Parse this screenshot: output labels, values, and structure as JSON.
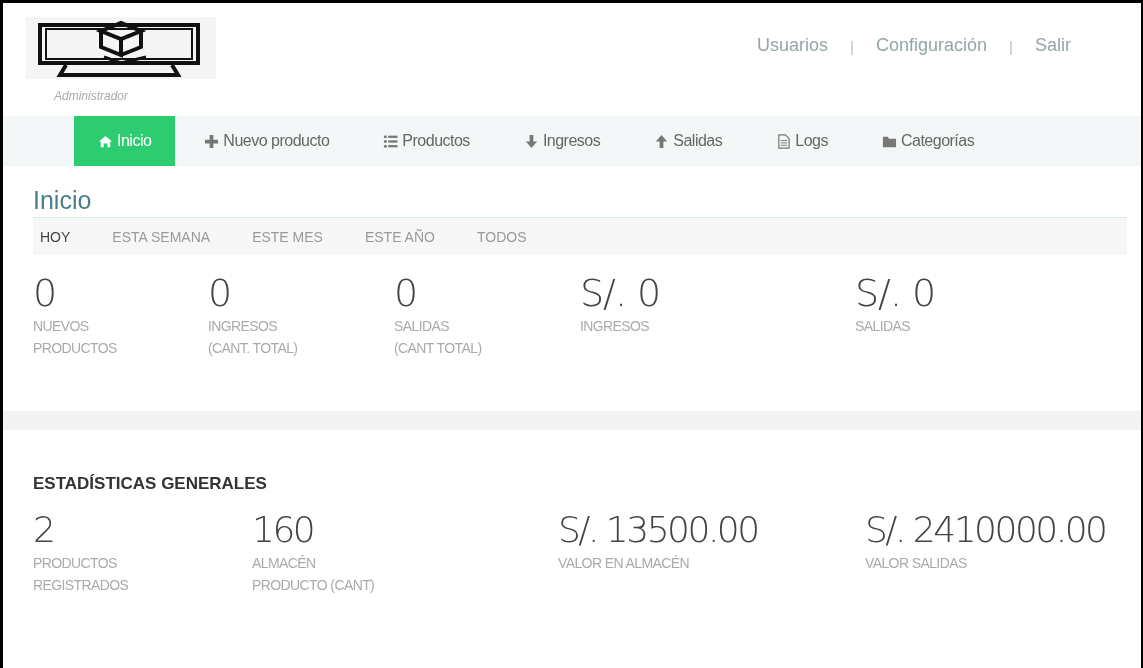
{
  "header": {
    "user_role": "Administrador",
    "links": [
      {
        "label": "Usuarios"
      },
      {
        "label": "Configuración"
      },
      {
        "label": "Salir"
      }
    ],
    "separators": [
      "|",
      "|"
    ]
  },
  "nav": [
    {
      "label": "Inicio",
      "kind": "home",
      "selected": true
    },
    {
      "label": "Nuevo producto",
      "kind": "plus",
      "selected": false
    },
    {
      "label": "Productos",
      "kind": "list",
      "selected": false
    },
    {
      "label": "Ingresos",
      "kind": "down",
      "selected": false
    },
    {
      "label": "Salidas",
      "kind": "up",
      "selected": false
    },
    {
      "label": "Logs",
      "kind": "file",
      "selected": false
    },
    {
      "label": "Categorías",
      "kind": "folder",
      "selected": false
    }
  ],
  "page_title": "Inicio",
  "period_tabs": [
    {
      "label": "HOY",
      "selected": true
    },
    {
      "label": "ESTA SEMANA",
      "selected": false
    },
    {
      "label": "ESTE MES",
      "selected": false
    },
    {
      "label": "ESTE AÑO",
      "selected": false
    },
    {
      "label": "TODOS",
      "selected": false
    }
  ],
  "period_stats": [
    {
      "value": "0",
      "label": [
        "NUEVOS",
        "PRODUCTOS"
      ]
    },
    {
      "value": "0",
      "label": [
        "INGRESOS",
        "(CANT. TOTAL)"
      ]
    },
    {
      "value": "0",
      "label": [
        "SALIDAS",
        "(CANT TOTAL)"
      ]
    },
    {
      "value": "S/. 0",
      "label": [
        "INGRESOS"
      ]
    },
    {
      "value": "S/. 0",
      "label": [
        "SALIDAS"
      ]
    }
  ],
  "general_title": "ESTADÍSTICAS GENERALES",
  "general_stats": [
    {
      "value": "2",
      "label": [
        "PRODUCTOS",
        "REGISTRADOS"
      ]
    },
    {
      "value": "160",
      "label": [
        "ALMACÉN",
        "PRODUCTO (CANT)"
      ]
    },
    {
      "value": "S/. 13500.00",
      "label": [
        "VALOR EN ALMACÉN"
      ]
    },
    {
      "value": "S/. 2410000.00",
      "label": [
        "VALOR SALIDAS"
      ]
    }
  ]
}
